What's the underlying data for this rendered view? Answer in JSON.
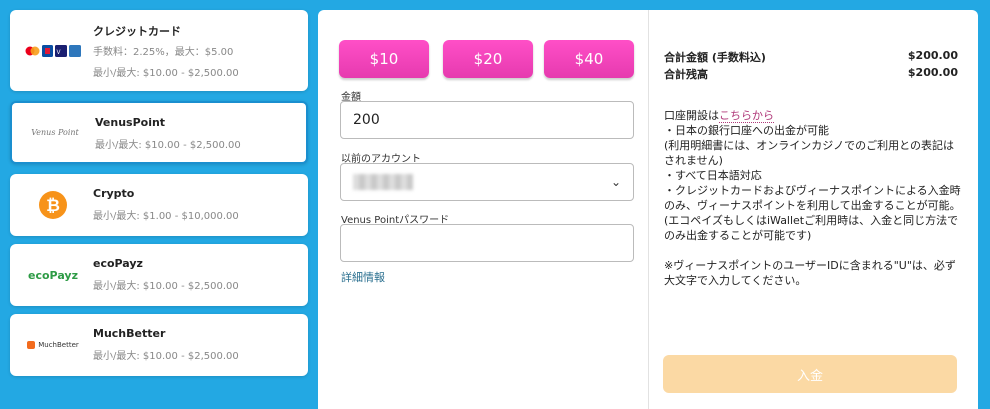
{
  "methods": [
    {
      "id": "credit",
      "name": "クレジットカード",
      "line1": "手数料：2.25%，最大：$5.00",
      "line2": "最小/最大: $10.00 - $2,500.00",
      "icon": "credit-cards-logo"
    },
    {
      "id": "venus",
      "name": "VenusPoint",
      "line1": "最小/最大: $10.00 - $2,500.00",
      "logo_text": "Venus Point",
      "icon": "venuspoint-logo",
      "selected": true
    },
    {
      "id": "crypto",
      "name": "Crypto",
      "line1": "最小/最大: $1.00 - $10,000.00",
      "icon": "bitcoin-icon"
    },
    {
      "id": "ecopayz",
      "name": "ecoPayz",
      "line1": "最小/最大: $10.00 - $2,500.00",
      "logo_text": "ecoPayz",
      "icon": "ecopayz-logo"
    },
    {
      "id": "muchbetter",
      "name": "MuchBetter",
      "line1": "最小/最大: $10.00 - $2,500.00",
      "logo_text": "MuchBetter",
      "icon": "muchbetter-logo"
    }
  ],
  "quick_amounts": [
    "$10",
    "$20",
    "$40"
  ],
  "form": {
    "amount_label": "金額",
    "amount_value": "200",
    "prev_account_label": "以前のアカウント",
    "password_label": "Venus Pointパスワード",
    "password_value": "",
    "details_link": "詳細情報"
  },
  "summary": {
    "total_label": "合計金額 (手数料込)",
    "total_value": "$200.00",
    "balance_label": "合計残高",
    "balance_value": "$200.00"
  },
  "info": {
    "open_prefix": "口座開設は",
    "open_link": "こちらから",
    "lines": [
      "・日本の銀行口座への出金が可能",
      "(利用明細書には、オンラインカジノでのご利用との表記はされません)",
      "・すべて日本語対応",
      "・クレジットカードおよびヴィーナスポイントによる入金時のみ、ヴィーナスポイントを利用して出金することが可能。",
      "(エコペイズもしくはiWalletご利用時は、入金と同じ方法でのみ出金することが可能です)"
    ],
    "note": "※ヴィーナスポイントのユーザーIDに含まれる\"U\"は、必ず大文字で入力してください。"
  },
  "deposit_label": "入金",
  "colors": {
    "background": "#23a8e3",
    "amount_button": "#ff4fc7",
    "deposit_button": "#fbd9a4",
    "link": "#b03a7a"
  }
}
